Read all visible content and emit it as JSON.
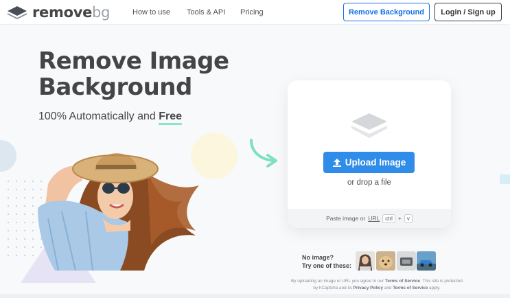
{
  "header": {
    "logo": {
      "word1": "remove",
      "word2": "bg",
      "icon": "layers-logo-icon"
    },
    "nav": [
      {
        "label": "How to use"
      },
      {
        "label": "Tools & API"
      },
      {
        "label": "Pricing"
      }
    ],
    "remove_background_label": "Remove Background",
    "login_label": "Login / Sign up"
  },
  "hero": {
    "title_line1": "Remove Image",
    "title_line2": "Background",
    "subtitle_prefix": "100% Automatically and ",
    "subtitle_emphasis": "Free"
  },
  "upload": {
    "button_label": "Upload Image",
    "button_icon": "upload-arrow-icon",
    "drop_text": "or drop a file",
    "paste_prefix": "Paste image or ",
    "paste_url": "URL",
    "kbd_ctrl": "ctrl",
    "kbd_plus": "+",
    "kbd_v": "v"
  },
  "samples": {
    "line1": "No image?",
    "line2": "Try one of these:",
    "thumbs": [
      "woman-thumb",
      "dog-thumb",
      "product-thumb",
      "car-thumb"
    ]
  },
  "legal": {
    "p1": "By uploading an image or URL you agree to our ",
    "terms": "Terms of Service",
    "p2": ". This site is protected by hCaptcha and its ",
    "privacy": "Privacy Policy",
    "p3": " and ",
    "terms2": "Terms of Service",
    "p4": " apply."
  },
  "colors": {
    "accent": "#0f70e6",
    "upload_button": "#2f8ce8",
    "free_underline": "#8ee3c8",
    "arrow": "#7fe0c0"
  }
}
